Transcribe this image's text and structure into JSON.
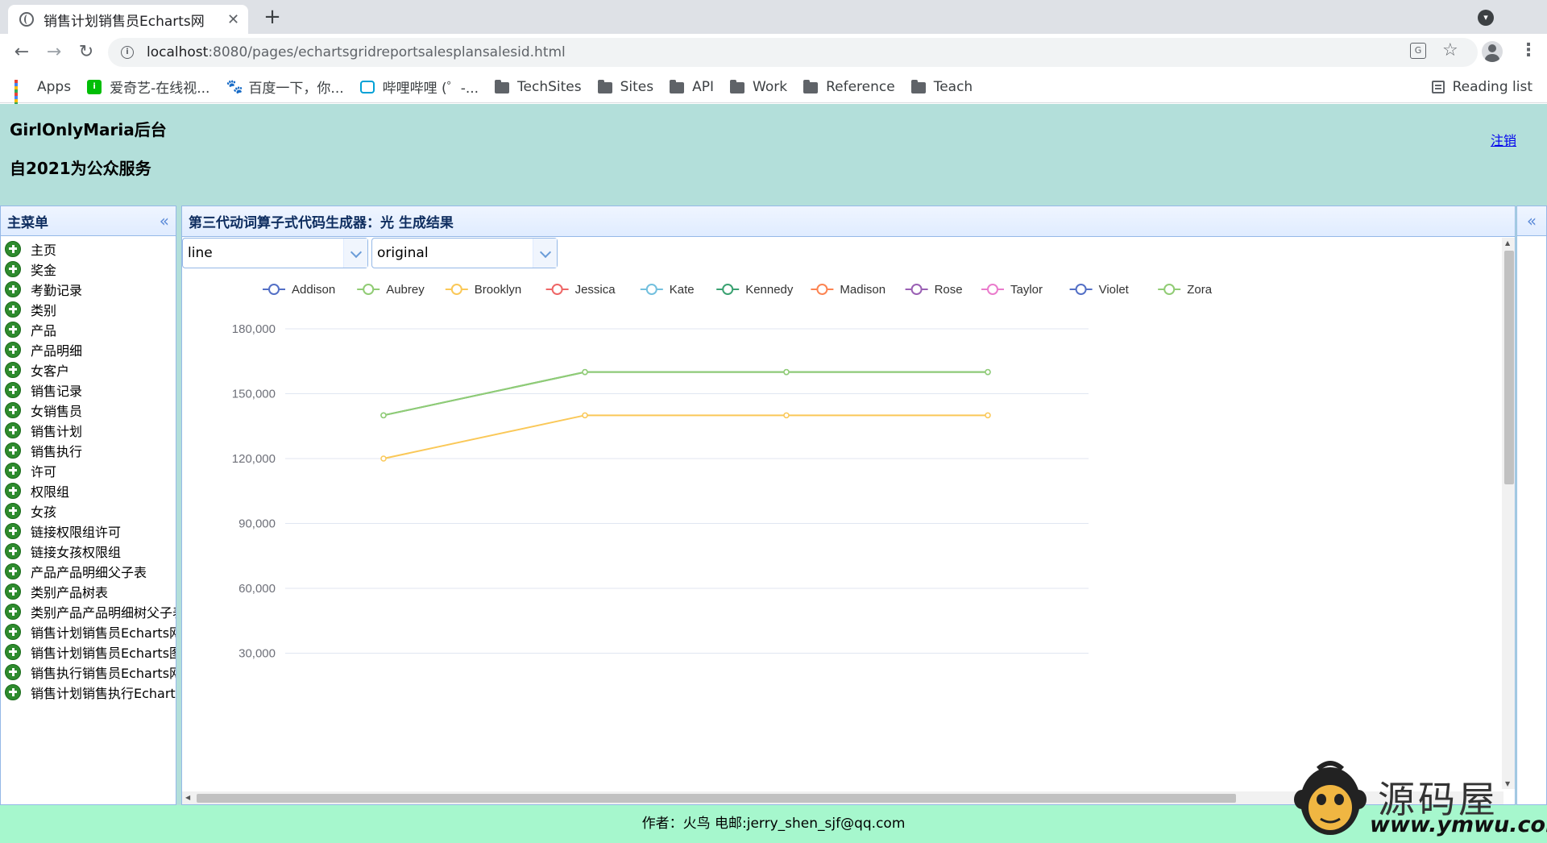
{
  "browser": {
    "tab_title": "销售计划销售员Echarts网",
    "tab_close": "✕",
    "new_tab": "+",
    "url_host": "localhost",
    "url_path": ":8080/pages/echartsgridreportsalesplansalesid.html",
    "bookmarks": [
      {
        "label": "Apps",
        "icon": "apps-icon"
      },
      {
        "label": "爱奇艺-在线视...",
        "icon": "iqiyi-icon"
      },
      {
        "label": "百度一下，你...",
        "icon": "baidu-icon"
      },
      {
        "label": "哔哩哔哩 (゜-...",
        "icon": "bilibili-icon"
      },
      {
        "label": "TechSites",
        "icon": "folder-icon"
      },
      {
        "label": "Sites",
        "icon": "folder-icon"
      },
      {
        "label": "API",
        "icon": "folder-icon"
      },
      {
        "label": "Work",
        "icon": "folder-icon"
      },
      {
        "label": "Reference",
        "icon": "folder-icon"
      },
      {
        "label": "Teach",
        "icon": "folder-icon"
      }
    ],
    "reading_list": "Reading list"
  },
  "header": {
    "title": "GirlOnlyMaria后台",
    "subtitle": "自2021为公众服务",
    "logout": "注销"
  },
  "sidebar": {
    "title": "主菜单",
    "collapse_glyph": "«",
    "items": [
      "主页",
      "奖金",
      "考勤记录",
      "类别",
      "产品",
      "产品明细",
      "女客户",
      "销售记录",
      "女销售员",
      "销售计划",
      "销售执行",
      "许可",
      "权限组",
      "女孩",
      "链接权限组许可",
      "链接女孩权限组",
      "产品产品明细父子表",
      "类别产品树表",
      "类别产品产品明细树父子表",
      "销售计划销售员Echarts网格报表",
      "销售计划销售员Echarts图表",
      "销售执行销售员Echarts网格报表",
      "销售计划销售执行Echarts图表"
    ]
  },
  "panel": {
    "title": "第三代动词算子式代码生成器：光   生成结果",
    "chart_type_select": "line",
    "data_mode_select": "original",
    "east_glyph": "«"
  },
  "chart_data": {
    "type": "line",
    "title": "",
    "xlabel": "",
    "ylabel": "",
    "ylim": [
      0,
      180000
    ],
    "yticks": [
      30000,
      60000,
      90000,
      120000,
      150000,
      180000
    ],
    "ytick_labels": [
      "30,000",
      "60,000",
      "90,000",
      "120,000",
      "150,000",
      "180,000"
    ],
    "legend_position": "top",
    "grid": true,
    "legend": [
      {
        "name": "Addison",
        "color": "#5470c6"
      },
      {
        "name": "Aubrey",
        "color": "#91cc75"
      },
      {
        "name": "Brooklyn",
        "color": "#fac858"
      },
      {
        "name": "Jessica",
        "color": "#ee6666"
      },
      {
        "name": "Kate",
        "color": "#73c0de"
      },
      {
        "name": "Kennedy",
        "color": "#3ba272"
      },
      {
        "name": "Madison",
        "color": "#fc8452"
      },
      {
        "name": "Rose",
        "color": "#9a60b4"
      },
      {
        "name": "Taylor",
        "color": "#ea7ccc"
      },
      {
        "name": "Violet",
        "color": "#5470c6"
      },
      {
        "name": "Zora",
        "color": "#91cc75"
      }
    ],
    "series": [
      {
        "name": "Brooklyn",
        "color": "#fac858",
        "values": [
          120000,
          140000,
          140000,
          140000
        ]
      },
      {
        "name": "Kennedy",
        "color": "#3ba272",
        "values": [
          140000,
          160000,
          160000,
          160000
        ]
      },
      {
        "name": "Aubrey",
        "color": "#91cc75",
        "values": [
          140000,
          160000,
          160000,
          160000
        ]
      }
    ]
  },
  "footer": {
    "text": "作者：火鸟 电邮:jerry_shen_sjf@qq.com"
  },
  "watermark": {
    "title": "源码屋",
    "url": "www.ymwu.com"
  }
}
